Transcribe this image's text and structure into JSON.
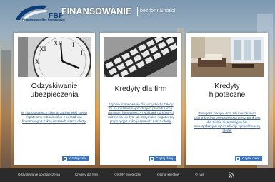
{
  "header": {
    "logo_text": "FBF",
    "logo_subtitle": "Finansowanie Bez Formalności",
    "site_title": "FINANSOWANIE",
    "tagline": "bez formalności"
  },
  "cards": [
    {
      "title_line1": "Odzyskiwanie",
      "title_line2": "ubezpieczenia",
      "text": "W ciągu ostatnich kilku lat zaciągnęłeś kredyt hipoteczny w banku i/lub z pośrednika finansowego? Kliknij i sprawdź naszą ofertę!",
      "button": "Czytaj dalej",
      "image_icon": "clock-image"
    },
    {
      "title_line1": "Kredyty dla firm",
      "title_line2": "",
      "text": "Szybkie finansowanie dla wszystkich! Zależy Ci na możliwie najprostszych procedurach i minimum formalności? Twój bank odmówił Ci udzielenia kredytu lub otrzymałeś negatywną propozycję? Kliknij i sprawdź naszą ofertę!",
      "button": "Czytaj dalej",
      "image_icon": "calculator-image"
    },
    {
      "title_line1": "Kredyty",
      "title_line2": "hipoteczne",
      "text": "Planujesz zakupić dom lub mieszkanie? Oferta kredytu przedstawiona przez Bank jest dla Ciebie nieatrakcyjna lub niesatysfakcjonująca? Kliknij i sprawdź naszą ofertę!",
      "button": "Czytaj dalej",
      "image_icon": "interior-image"
    }
  ],
  "footer": {
    "links": [
      "Odzyskiwanie ubezpieczenia",
      "Kredyty dla firm",
      "Kredyty hipoteczne",
      "Opinie klientów",
      "O nas"
    ],
    "rss_icon": "rss-icon"
  },
  "colors": {
    "brand_blue": "#0d3b73",
    "button_blue": "#3f72b5",
    "footer_bg": "#2b2b2b"
  }
}
